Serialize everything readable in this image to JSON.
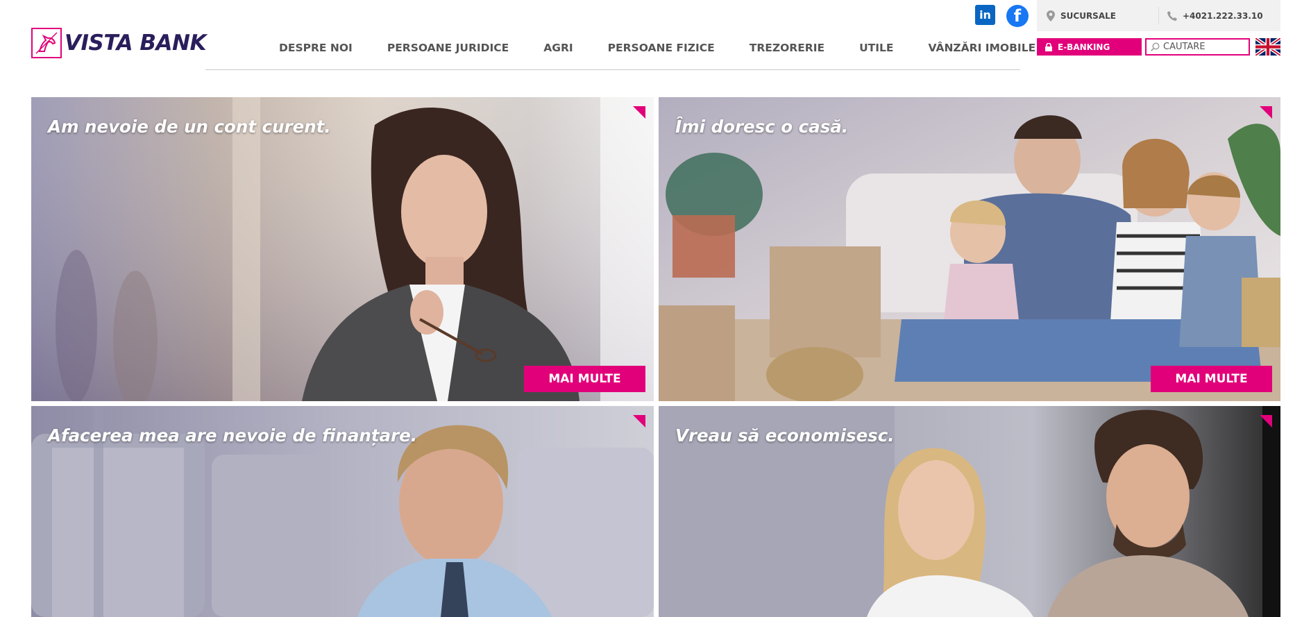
{
  "brand": {
    "name": "VISTA BANK",
    "accent_color": "#e2007a",
    "text_color": "#2a1e5c"
  },
  "social": {
    "linkedin_label": "in",
    "facebook_label": "f"
  },
  "topbar": {
    "branches_label": "SUCURSALE",
    "phone": "+4021.222.33.10",
    "branches_icon": "map-pin-icon",
    "phone_icon": "phone-icon"
  },
  "ebanking": {
    "label": "E-BANKING",
    "icon": "lock-icon"
  },
  "search": {
    "placeholder": "CAUTARE",
    "value": ""
  },
  "language": {
    "flag": "uk-flag-icon"
  },
  "nav": {
    "items": [
      {
        "label": "DESPRE NOI"
      },
      {
        "label": "PERSOANE JURIDICE"
      },
      {
        "label": "AGRI"
      },
      {
        "label": "PERSOANE FIZICE"
      },
      {
        "label": "TREZORERIE"
      },
      {
        "label": "UTILE"
      },
      {
        "label": "VÂNZĂRI IMOBILE"
      }
    ]
  },
  "tiles": [
    {
      "headline": "Am nevoie de un cont curent.",
      "button": "MAI MULTE"
    },
    {
      "headline": "Îmi doresc o casă.",
      "button": "MAI MULTE"
    },
    {
      "headline": "Afacerea mea are nevoie de finanțare."
    },
    {
      "headline": "Vreau să economisesc."
    }
  ]
}
